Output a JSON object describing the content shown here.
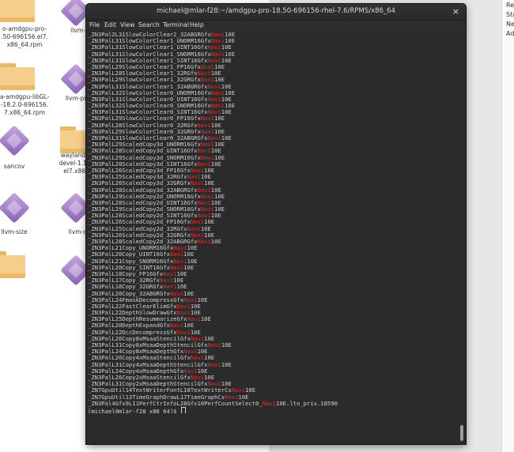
{
  "desktop": {
    "right_panel_items": [
      "Re",
      "Sta",
      "Ne",
      "Ad"
    ],
    "icons": [
      {
        "label": "o-amdgpu-pro-\n.50-696156.el7.\nx86_64.rpm",
        "kind": "folder"
      },
      {
        "label": "llvm-rc",
        "kind": "diamond"
      },
      {
        "label": "a-amdgpu-libGL-\n-18.2.0-696156.\n7.x86_64.rpm",
        "kind": "folder"
      },
      {
        "label": "llvm-profd",
        "kind": "diamond"
      },
      {
        "label": "sancov",
        "kind": "diamond"
      },
      {
        "label": "wayland-amd\ndevel-1.15.0-6\nel7.x86_64.",
        "kind": "folder"
      },
      {
        "label": "llvm-size",
        "kind": "diamond"
      },
      {
        "label": "llvm-diff",
        "kind": "diamond"
      }
    ]
  },
  "terminal": {
    "title": "michael@mlar-f28:~/amdgpu-pro-18.50-696156-rhel-7.6/RPMS/x86_64",
    "close_glyph": "×",
    "menu": [
      "File",
      "Edit",
      "View",
      "Search",
      "Terminal",
      "Help"
    ],
    "lines": [
      [
        "_ZN3Pal2L31SlowColorClear2_32ABGRGfx",
        "Navi",
        "10E",
        ""
      ],
      [
        "_ZN3PalL31SlowColorClear1_UNORM16Gfx",
        "Navi",
        "10E",
        ""
      ],
      [
        "_ZN3PalL31SlowColorClear1_UINT16Gfx",
        "Navi",
        "10E",
        ""
      ],
      [
        "_ZN3PalL31SlowColorClear1_SNORM16Gfx",
        "Navi",
        "10E",
        ""
      ],
      [
        "_ZN3PalL31SlowColorClear1_SINT16Gfx",
        "Navi",
        "10E",
        ""
      ],
      [
        "_ZN3PalL29SlowColorClear1_FP16Gfx",
        "Navi",
        "10E",
        ""
      ],
      [
        "_ZN3PalL28SlowColorClear1_32RGfx",
        "Navi",
        "10E",
        ""
      ],
      [
        "_ZN3PalL29SlowColorClear1_32GRGfx",
        "Navi",
        "10E",
        ""
      ],
      [
        "_ZN3PalL31SlowColorClear1_32ABGRGfx",
        "Navi",
        "10E",
        ""
      ],
      [
        "_ZN3PalL32SlowColorClear0_UNORM16Gfx",
        "Navi",
        "10E",
        ""
      ],
      [
        "_ZN3PalL31SlowColorClear0_UINT16Gfx",
        "Navi",
        "10E",
        ""
      ],
      [
        "_ZN3PalL32SlowColorClear0_SNORM16Gfx",
        "Navi",
        "10E",
        ""
      ],
      [
        "_ZN3PalL31SlowColorClear0_SINT16Gfx",
        "Navi",
        "10E",
        ""
      ],
      [
        "_ZN3PalL29SlowColorClear0_FP16Gfx",
        "Navi",
        "10E",
        ""
      ],
      [
        "_ZN3PalL28SlowColorClear0_32RGfx",
        "Navi",
        "10E",
        ""
      ],
      [
        "_ZN3PalL29SlowColorClear0_32GRGfx",
        "Navi",
        "10E",
        ""
      ],
      [
        "_ZN3PalL31SlowColorClear0_32ABGRGfx",
        "Navi",
        "10E",
        ""
      ],
      [
        "_ZN3PalL29ScaledCopy3d_UNORM16Gfx",
        "Navi",
        "10E",
        ""
      ],
      [
        "_ZN3PalL28ScaledCopy3d_UINT16Gfx",
        "Navi",
        "10E",
        ""
      ],
      [
        "_ZN3PalL29ScaledCopy3d_SNORM16Gfx",
        "Navi",
        "10E",
        ""
      ],
      [
        "_ZN3PalL28ScaledCopy3d_SINT16Gfx",
        "Navi",
        "10E",
        ""
      ],
      [
        "_ZN3PalL26ScaledCopy3d_FP16Gfx",
        "Navi",
        "10E",
        ""
      ],
      [
        "_ZN3PalL25ScaledCopy3d_32RGfx",
        "Navi",
        "10E",
        ""
      ],
      [
        "_ZN3PalL26ScaledCopy3d_32GRGfx",
        "Navi",
        "10E",
        ""
      ],
      [
        "_ZN3PalL28ScaledCopy3d_32ABGRGfx",
        "Navi",
        "10E",
        ""
      ],
      [
        "_ZN3PalL29ScaledCopy2d_UNORM16Gfx",
        "Navi",
        "10E",
        ""
      ],
      [
        "_ZN3PalL28ScaledCopy2d_UINT16Gfx",
        "Navi",
        "10E",
        ""
      ],
      [
        "_ZN3PalL29ScaledCopy2d_SNORM16Gfx",
        "Navi",
        "10E",
        ""
      ],
      [
        "_ZN3PalL28ScaledCopy2d_SINT16Gfx",
        "Navi",
        "10E",
        ""
      ],
      [
        "_ZN3PalL26ScaledCopy2d_FP16Gfx",
        "Navi",
        "10E",
        ""
      ],
      [
        "_ZN3PalL25ScaledCopy2d_32RGfx",
        "Navi",
        "10E",
        ""
      ],
      [
        "_ZN3PalL26ScaledCopy2d_32GRGfx",
        "Navi",
        "10E",
        ""
      ],
      [
        "_ZN3PalL28ScaledCopy2d_32ABGRGfx",
        "Navi",
        "10E",
        ""
      ],
      [
        "_ZN3PalL21Copy_UNORM16Gfx",
        "Navi",
        "10E",
        ""
      ],
      [
        "_ZN3PalL20Copy_UINT16Gfx",
        "Navi",
        "10E",
        ""
      ],
      [
        "_ZN3PalL21Copy_SNORM16Gfx",
        "Navi",
        "10E",
        ""
      ],
      [
        "_ZN3PalL20Copy_SINT16Gfx",
        "Navi",
        "10E",
        ""
      ],
      [
        "_ZN3PalL18Copy_FP16Gfx",
        "Navi",
        "10E",
        ""
      ],
      [
        "_ZN3PalL17Copy_32RGfx",
        "Navi",
        "10E",
        ""
      ],
      [
        "_ZN3PalL18Copy_32GRGfx",
        "Navi",
        "10E",
        ""
      ],
      [
        "_ZN3PalL20Copy_32ABGRGfx",
        "Navi",
        "10E",
        ""
      ],
      [
        "_ZN3PalL24FmaskDecompressGfx",
        "Navi",
        "10E",
        ""
      ],
      [
        "_ZN3PalL22FastClearElimGfx",
        "Navi",
        "10E",
        ""
      ],
      [
        "_ZN3PalL22DepthSlowDrawGfx",
        "Navi",
        "10E",
        ""
      ],
      [
        "_ZN3PalL25DepthResummarizeGfx",
        "Navi",
        "10E",
        ""
      ],
      [
        "_ZN3PalL20DepthExpandGfx",
        "Navi",
        "10E",
        ""
      ],
      [
        "_ZN3PalL22DccDecompressGfx",
        "Navi",
        "10E",
        ""
      ],
      [
        "_ZN3PalL26Copy8xMsaaStencilGfx",
        "Navi",
        "10E",
        ""
      ],
      [
        "_ZN3PalL31Copy8xMsaaDepthStencilGfx",
        "Navi",
        "10E",
        ""
      ],
      [
        "_ZN3PalL24Copy8xMsaaDepthGfx",
        "Navi",
        "10E",
        ""
      ],
      [
        "_ZN3PalL26Copy4xMsaaStencilGfx",
        "Navi",
        "10E",
        ""
      ],
      [
        "_ZN3PalL31Copy4xMsaaDepthStencilGfx",
        "Navi",
        "10E",
        ""
      ],
      [
        "_ZN3PalL24Copy4xMsaaDepthGfx",
        "Navi",
        "10E",
        ""
      ],
      [
        "_ZN3PalL26Copy2xMsaaStencilGfx",
        "Navi",
        "10E",
        ""
      ],
      [
        "_ZN3PalL31Copy2xMsaaDepthStencilGfx",
        "Navi",
        "10E",
        ""
      ],
      [
        "_ZN7GpuUtil14TextWriterFontL18TextWriterCs",
        "Navi",
        "10E",
        ""
      ],
      [
        "_ZN7GpuUtil13TimeGraphDrawL17TimeGraphCs",
        "Navi",
        "10E",
        ""
      ],
      [
        "_ZN3Pal4Gfx9L11PerfCtrInfoL28Gfx10PerfCountSelect0_",
        "Navi",
        "10E",
        ".lto_priv.18590"
      ]
    ],
    "prompt": "[michael@mlar-f28 x86_64]$ ",
    "colors": {
      "background": "#2b2b2b",
      "text": "#d0d0d0",
      "highlight": "#ef2929"
    }
  }
}
